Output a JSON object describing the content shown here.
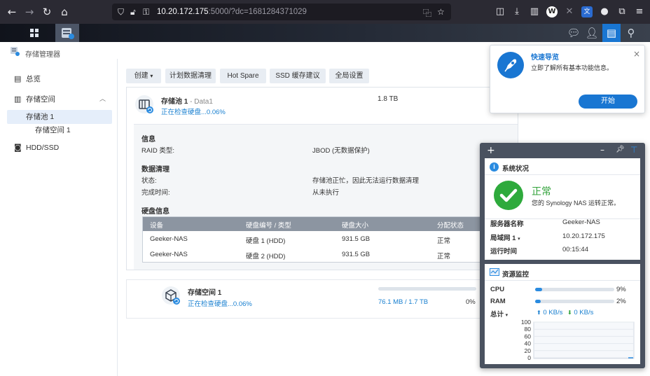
{
  "browser": {
    "url_host": "10.20.172.175",
    "url_rest": ":5000/?dc=1681284371029"
  },
  "app": {
    "title": "存储管理器",
    "sidebar": [
      {
        "label": "总览"
      },
      {
        "label": "存储空间"
      },
      {
        "label": "存储池 1"
      },
      {
        "label": "存储空间 1"
      },
      {
        "label": "HDD/SSD"
      }
    ]
  },
  "toolbar": {
    "create": "创建",
    "scrub": "计划数据清理",
    "hot_spare": "Hot Spare",
    "ssd_cache": "SSD 缓存建议",
    "global": "全局设置"
  },
  "pool": {
    "name": "存储池 1",
    "separator": "-",
    "subtitle": "Data1",
    "status": "正在检查硬盘...0.06%",
    "size": "1.8 TB",
    "info_header": "信息",
    "raid_label": "RAID 类型:",
    "raid_value": "JBOD (无数据保护)",
    "scrub_header": "数据清理",
    "state_label": "状态:",
    "state_value": "存储池正忙，因此无法运行数据清理",
    "done_label": "完成时间:",
    "done_value": "从未执行",
    "disk_header": "硬盘信息",
    "columns": [
      "设备",
      "硬盘编号 / 类型",
      "硬盘大小",
      "分配状态"
    ],
    "disks": [
      {
        "device": "Geeker-NAS",
        "slot": "硬盘 1 (HDD)",
        "size": "931.5 GB",
        "status": "正常"
      },
      {
        "device": "Geeker-NAS",
        "slot": "硬盘 2 (HDD)",
        "size": "931.5 GB",
        "status": "正常"
      }
    ]
  },
  "volume": {
    "name": "存储空间 1",
    "status": "正在检查硬盘...0.06%",
    "usage": "76.1 MB / 1.7 TB",
    "percent": "0%",
    "usage_fraction": 0
  },
  "quick_start": {
    "title": "快速导览",
    "desc": "立即了解所有基本功能信息。",
    "button": "开始"
  },
  "widget": {
    "status_title": "系统状况",
    "status_value": "正常",
    "status_desc": "您的 Synology NAS 运转正常。",
    "server_label": "服务器名称",
    "server_value": "Geeker-NAS",
    "lan_label": "局域网 1",
    "lan_value": "10.20.172.175",
    "uptime_label": "运行时间",
    "uptime_value": "00:15:44",
    "monitor_title": "资源监控",
    "cpu_label": "CPU",
    "cpu_pct": "9%",
    "cpu_fraction": 0.09,
    "ram_label": "RAM",
    "ram_pct": "2%",
    "ram_fraction": 0.02,
    "total_label": "总计",
    "up_rate": "0 KB/s",
    "down_rate": "0 KB/s",
    "y_ticks": [
      "100",
      "80",
      "60",
      "40",
      "20",
      "0"
    ]
  },
  "colors": {
    "accent": "#1976d2",
    "ok": "#31a23a",
    "link": "#1a80d0"
  }
}
